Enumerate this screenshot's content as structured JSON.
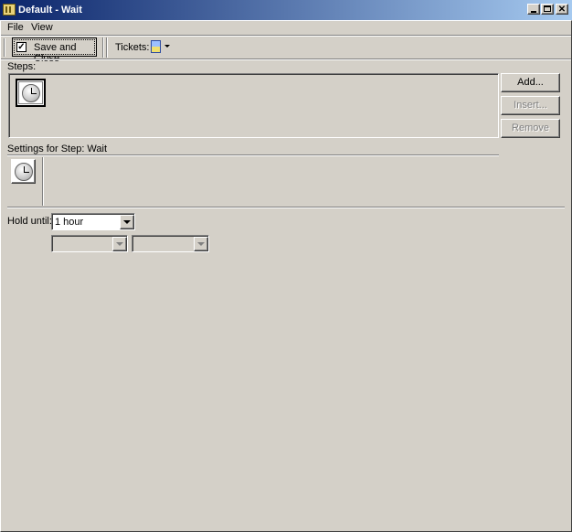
{
  "window": {
    "title": "Default - Wait"
  },
  "menu": {
    "file": "File",
    "view": "View"
  },
  "toolbar": {
    "save_close_label": "Save and Close",
    "tickets_label": "Tickets:"
  },
  "steps": {
    "label": "Steps:"
  },
  "buttons": {
    "add": "Add...",
    "insert": "Insert...",
    "remove": "Remove"
  },
  "settings": {
    "label": "Settings for Step: Wait"
  },
  "hold": {
    "label": "Hold until:",
    "selected": "1 hour"
  }
}
